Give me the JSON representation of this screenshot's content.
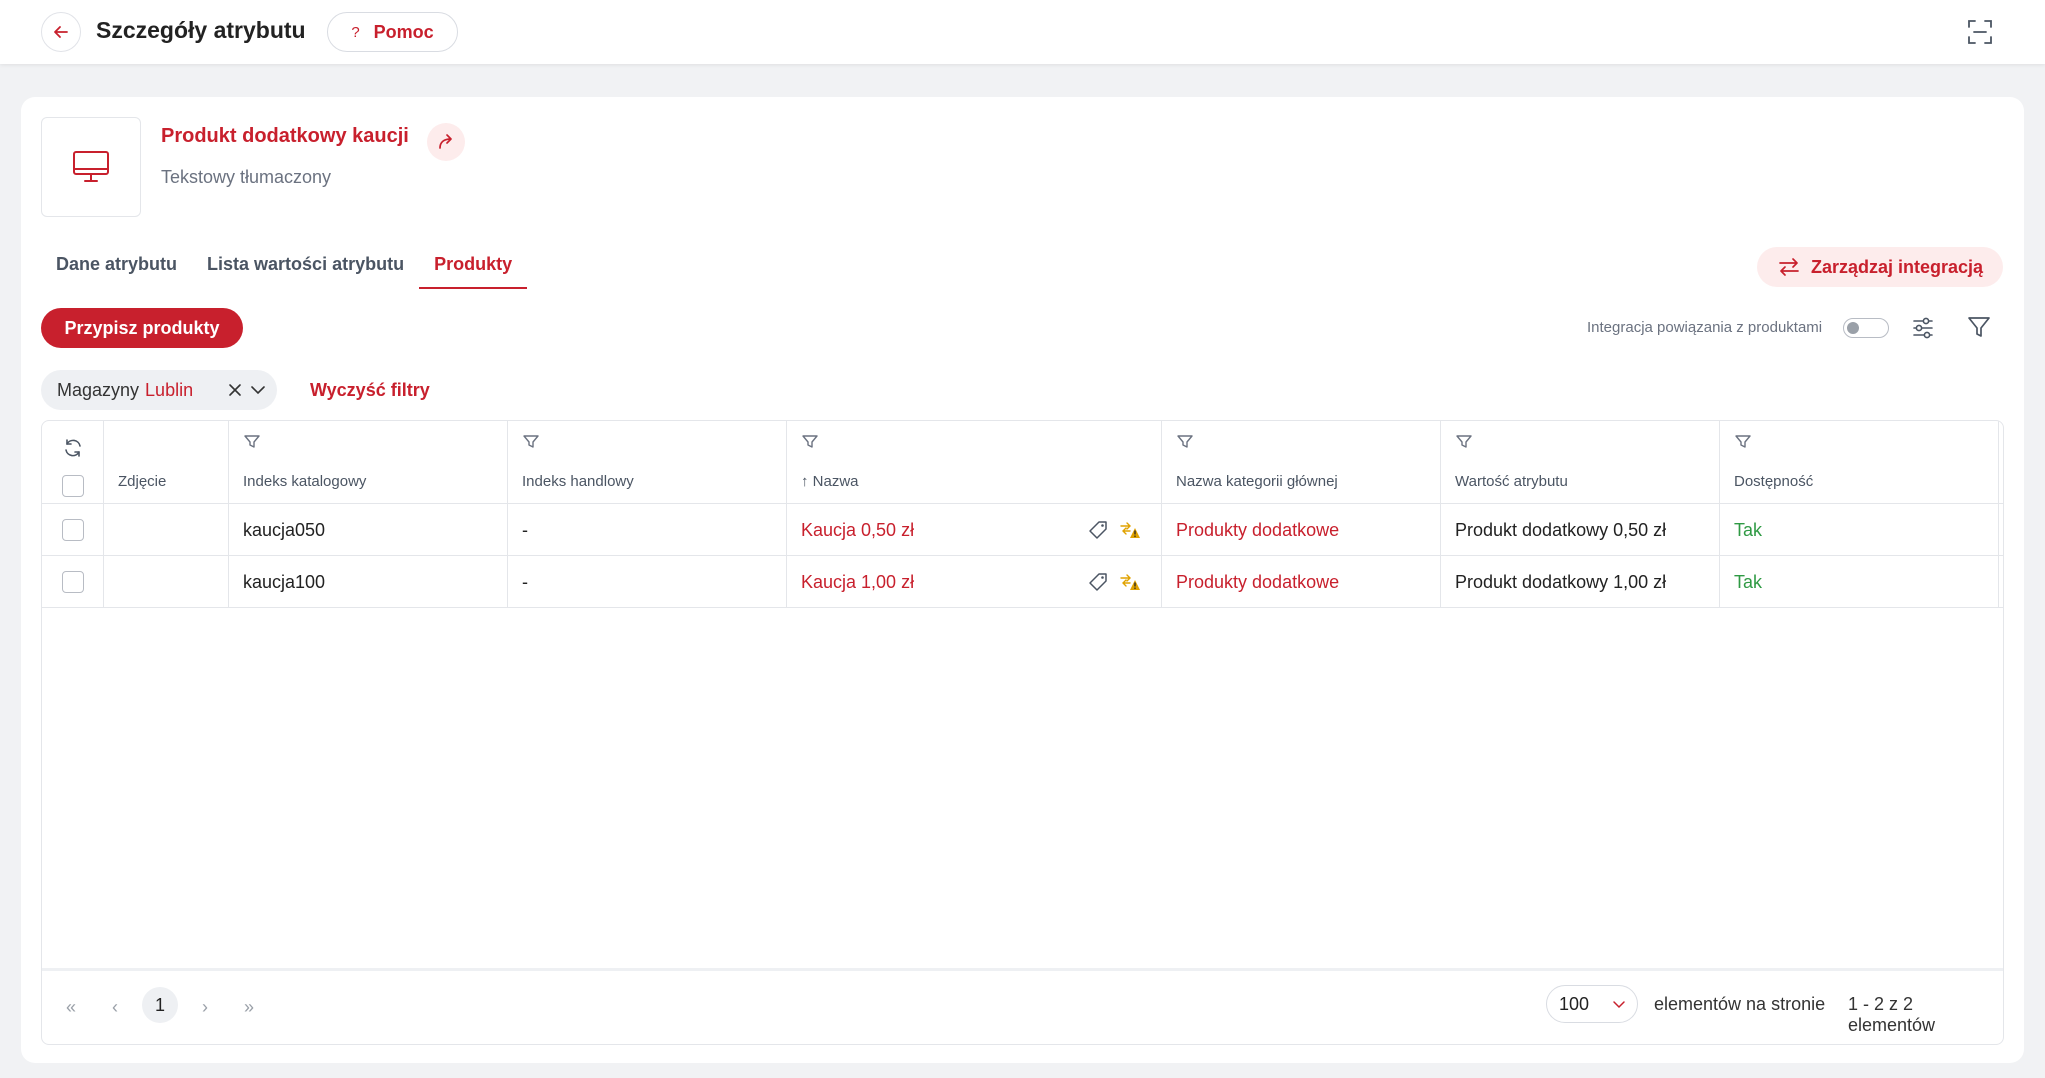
{
  "header": {
    "title": "Szczegóły atrybutu",
    "help_label": "Pomoc",
    "help_glyph": "?"
  },
  "attribute": {
    "name": "Produkt dodatkowy kaucji",
    "type": "Tekstowy tłumaczony"
  },
  "tabs": [
    {
      "label": "Dane atrybutu",
      "active": false
    },
    {
      "label": "Lista wartości atrybutu",
      "active": false
    },
    {
      "label": "Produkty",
      "active": true
    }
  ],
  "toolbar": {
    "manage_integration_label": "Zarządzaj integracją",
    "assign_products_label": "Przypisz produkty",
    "integration_toggle_label": "Integracja powiązania z produktami",
    "integration_toggle_on": false
  },
  "filters": {
    "chip_key": "Magazyny",
    "chip_value": "Lublin",
    "clear_label": "Wyczyść filtry"
  },
  "table": {
    "columns": {
      "photo": "Zdjęcie",
      "catalog_index": "Indeks katalogowy",
      "trade_index": "Indeks handlowy",
      "name": "Nazwa",
      "name_sort_glyph": "↑",
      "main_category": "Nazwa kategorii głównej",
      "attribute_value": "Wartość atrybutu",
      "availability": "Dostępność"
    },
    "rows": [
      {
        "catalog_index": "kaucja050",
        "trade_index": "-",
        "name": "Kaucja 0,50 zł",
        "main_category": "Produkty dodatkowe",
        "attribute_value": "Produkt dodatkowy 0,50 zł",
        "availability": "Tak"
      },
      {
        "catalog_index": "kaucja100",
        "trade_index": "-",
        "name": "Kaucja 1,00 zł",
        "main_category": "Produkty dodatkowe",
        "attribute_value": "Produkt dodatkowy 1,00 zł",
        "availability": "Tak"
      }
    ]
  },
  "pagination": {
    "current_page": "1",
    "page_size": "100",
    "per_page_label": "elementów na stronie",
    "range_label": "1 - 2 z 2 elementów",
    "first_glyph": "«",
    "prev_glyph": "‹",
    "next_glyph": "›",
    "last_glyph": "»"
  },
  "colors": {
    "accent": "#c8202d",
    "accent_soft": "#fdecec",
    "success": "#2f9a44",
    "warning": "#e0a200"
  }
}
